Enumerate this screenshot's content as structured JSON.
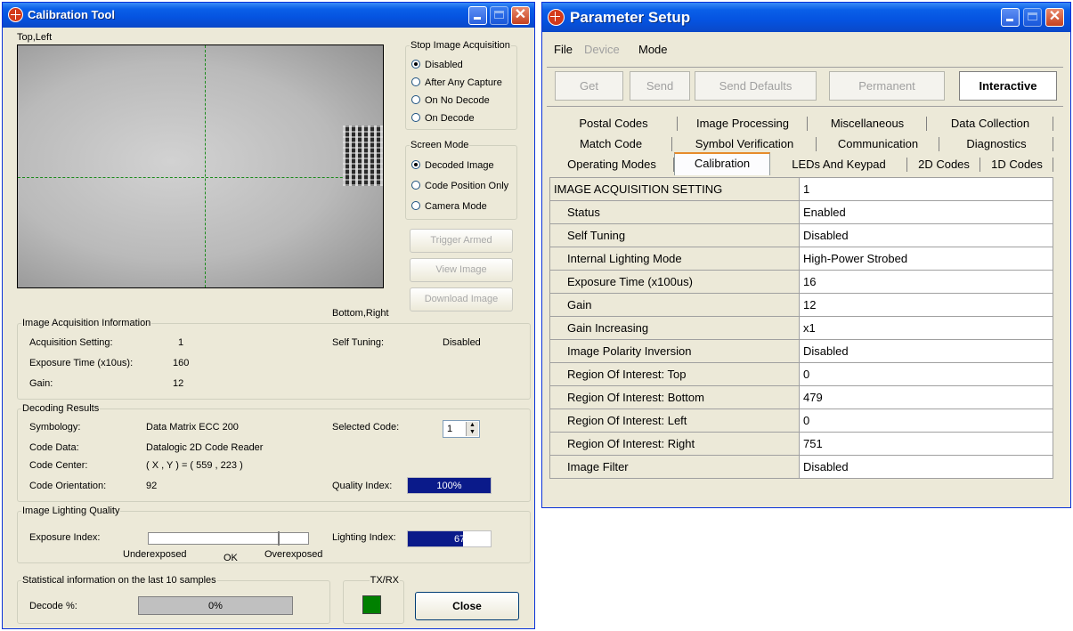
{
  "calibration": {
    "title": "Calibration Tool",
    "image": {
      "top_left": "Top,Left",
      "bottom_right": "Bottom,Right"
    },
    "stop_acquisition": {
      "legend": "Stop Image Acquisition",
      "options": [
        "Disabled",
        "After Any Capture",
        "On No Decode",
        "On Decode"
      ],
      "selected": "Disabled"
    },
    "screen_mode": {
      "legend": "Screen Mode",
      "options": [
        "Decoded Image",
        "Code Position Only",
        "Camera Mode"
      ],
      "selected": "Decoded Image"
    },
    "buttons": {
      "trigger": "Trigger Armed",
      "view": "View Image",
      "download": "Download Image",
      "close": "Close"
    },
    "acq_info": {
      "legend": "Image Acquisition Information",
      "acq_setting_label": "Acquisition Setting:",
      "acq_setting_value": "1",
      "exposure_label": "Exposure Time (x10us):",
      "exposure_value": "160",
      "gain_label": "Gain:",
      "gain_value": "12",
      "self_tuning_label": "Self Tuning:",
      "self_tuning_value": "Disabled"
    },
    "decoding": {
      "legend": "Decoding Results",
      "symbology_label": "Symbology:",
      "symbology_value": "Data Matrix ECC 200",
      "code_data_label": "Code Data:",
      "code_data_value": "Datalogic 2D Code Reader",
      "code_center_label": "Code Center:",
      "code_center_value": "( X , Y ) = ( 559 , 223 )",
      "orientation_label": "Code Orientation:",
      "orientation_value": "92",
      "selected_code_label": "Selected Code:",
      "selected_code_value": "1",
      "quality_label": "Quality Index:",
      "quality_value": "100%"
    },
    "lighting": {
      "legend": "Image Lighting Quality",
      "exposure_index_label": "Exposure Index:",
      "under": "Underexposed",
      "ok": "OK",
      "over": "Overexposed",
      "lighting_index_label": "Lighting Index:",
      "lighting_index_value": "67%"
    },
    "stats": {
      "legend": "Statistical information on the last 10 samples",
      "decode_label": "Decode %:",
      "decode_value": "0%"
    },
    "txrx": {
      "legend": "TX/RX",
      "color": "#008000"
    }
  },
  "parameter": {
    "title": "Parameter Setup",
    "menu": [
      "File",
      "Device",
      "Mode"
    ],
    "buttons": [
      "Get",
      "Send",
      "Send Defaults",
      "Permanent",
      "Interactive"
    ],
    "tabs_row1": [
      "Postal Codes",
      "Image Processing",
      "Miscellaneous",
      "Data Collection"
    ],
    "tabs_row2": [
      "Match Code",
      "Symbol Verification",
      "Communication",
      "Diagnostics"
    ],
    "tabs_row3": [
      "Operating Modes",
      "Calibration",
      "LEDs And Keypad",
      "2D Codes",
      "1D Codes"
    ],
    "active_tab": "Calibration",
    "rows": [
      {
        "key": "IMAGE ACQUISITION SETTING",
        "value": "1"
      },
      {
        "key": "Status",
        "value": "Enabled"
      },
      {
        "key": "Self Tuning",
        "value": "Disabled"
      },
      {
        "key": "Internal Lighting Mode",
        "value": "High-Power Strobed"
      },
      {
        "key": "Exposure Time (x100us)",
        "value": "16"
      },
      {
        "key": "Gain",
        "value": "12"
      },
      {
        "key": "Gain Increasing",
        "value": "x1"
      },
      {
        "key": "Image Polarity Inversion",
        "value": "Disabled"
      },
      {
        "key": "Region Of Interest: Top",
        "value": "0"
      },
      {
        "key": "Region Of Interest: Bottom",
        "value": "479"
      },
      {
        "key": "Region Of Interest: Left",
        "value": "0"
      },
      {
        "key": "Region Of Interest: Right",
        "value": "751"
      },
      {
        "key": "Image Filter",
        "value": "Disabled"
      }
    ]
  }
}
